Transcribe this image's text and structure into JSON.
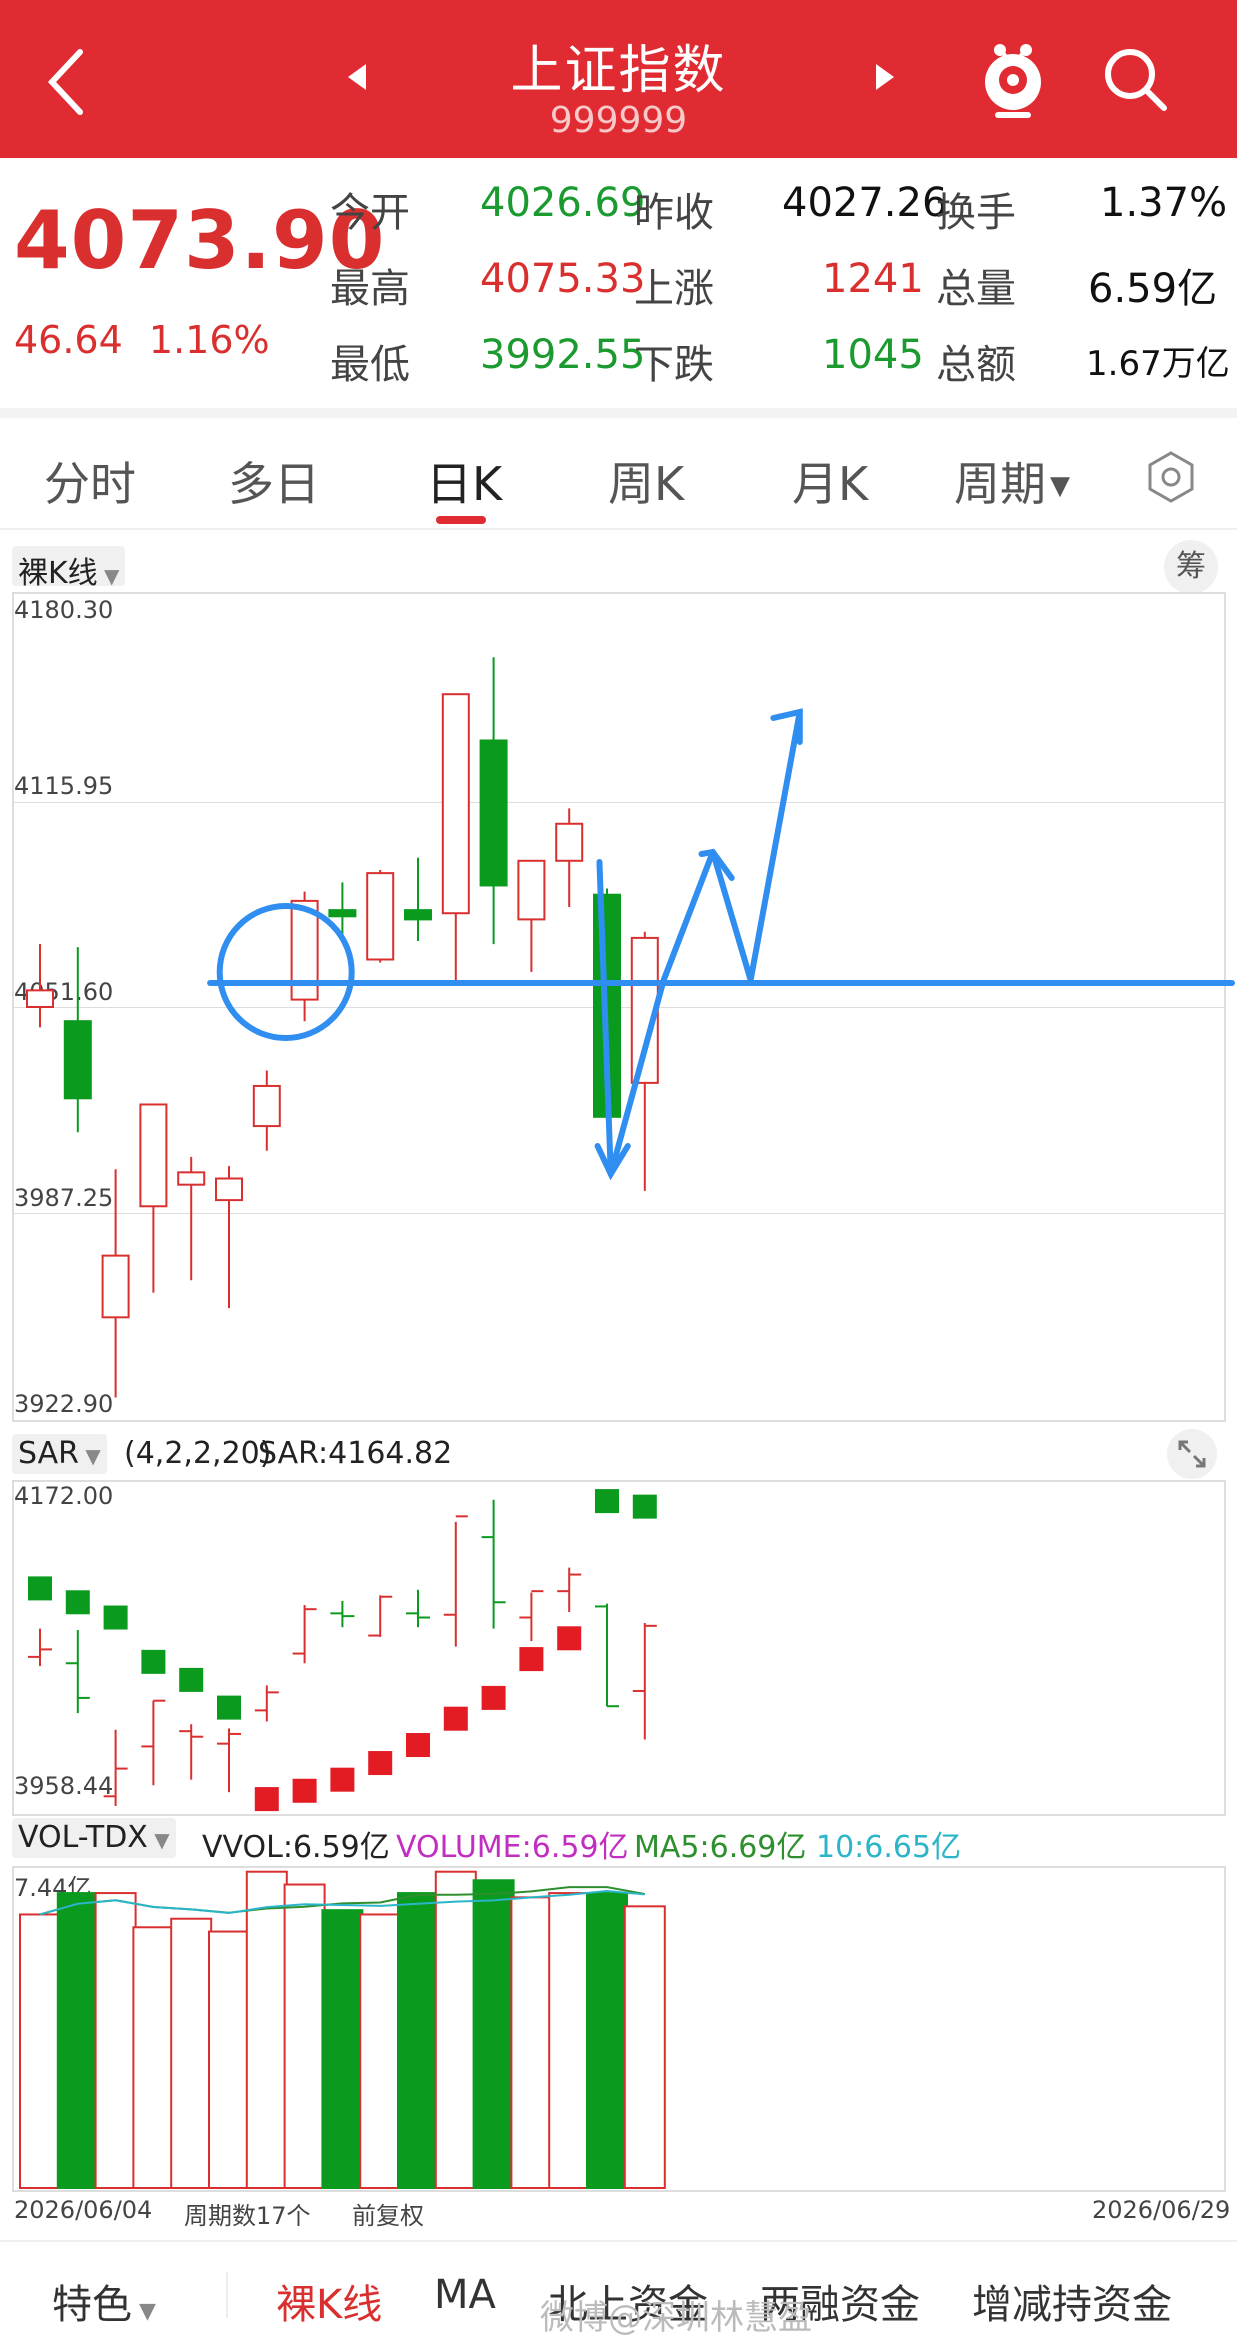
{
  "header": {
    "title": "上证指数",
    "code": "999999"
  },
  "quote": {
    "price": "4073.90",
    "change": "46.64",
    "change_pct": "1.16%",
    "rows": [
      {
        "l1": "今开",
        "v1": "4026.69",
        "c1": "green",
        "l2": "昨收",
        "v2": "4027.26",
        "c2": "black",
        "l3": "换手",
        "v3": "1.37%"
      },
      {
        "l1": "最高",
        "v1": "4075.33",
        "c1": "red",
        "l2": "上涨",
        "v2": "1241",
        "c2": "red",
        "l3": "总量",
        "v3": "6.59亿"
      },
      {
        "l1": "最低",
        "v1": "3992.55",
        "c1": "green",
        "l2": "下跌",
        "v2": "1045",
        "c2": "green",
        "l3": "总额",
        "v3": "1.67万亿"
      }
    ]
  },
  "tabs": {
    "items": [
      "分时",
      "多日",
      "日K",
      "周K",
      "月K",
      "周期"
    ],
    "active": "日K"
  },
  "kline": {
    "selector": "裸K线",
    "badge": "筹",
    "ticks": [
      "4180.30",
      "4115.95",
      "4051.60",
      "3987.25",
      "3922.90"
    ]
  },
  "sar": {
    "selector": "SAR",
    "params": "(4,2,2,20)",
    "value": "SAR:4164.82",
    "ticks": [
      "4172.00",
      "3958.44"
    ]
  },
  "vol": {
    "selector": "VOL-TDX",
    "vvol": "VVOL:6.59亿",
    "volume": "VOLUME:6.59亿",
    "ma5": "MA5:6.69亿",
    "ma10": "10:6.65亿",
    "top": "7.44亿",
    "date_start": "2026/06/04",
    "period": "周期数17个",
    "adjust": "前复权",
    "date_end": "2026/06/29"
  },
  "bottomnav": {
    "items": [
      "特色",
      "裸K线",
      "MA",
      "北上资金",
      "两融资金",
      "增减持资金"
    ],
    "active": "裸K线"
  },
  "watermark": "微博@深圳林慧盈",
  "colors": {
    "up": "#d9302f",
    "down": "#0a9a1e",
    "accent": "#e12b32",
    "annotation": "#2f8ef0"
  },
  "chart_data": [
    {
      "type": "candlestick",
      "title": "日K",
      "ylim": [
        3922.9,
        4180.3
      ],
      "x": [
        "2026/06/04",
        "",
        "",
        "",
        "",
        "",
        "",
        "",
        "",
        "",
        "",
        "",
        "",
        "",
        "",
        "",
        "2026/06/29"
      ],
      "ohlc": [
        {
          "o": 4051.6,
          "h": 4072,
          "l": 4045,
          "c": 4057,
          "up": true
        },
        {
          "o": 4047,
          "h": 4071,
          "l": 4011,
          "c": 4022,
          "up": false
        },
        {
          "o": 3951,
          "h": 3999,
          "l": 3925,
          "c": 3971,
          "up": true
        },
        {
          "o": 3987,
          "h": 4020,
          "l": 3959,
          "c": 4020,
          "up": true
        },
        {
          "o": 3998,
          "h": 4003,
          "l": 3963,
          "c": 3994,
          "up": true
        },
        {
          "o": 3989,
          "h": 4000,
          "l": 3954,
          "c": 3996,
          "up": true
        },
        {
          "o": 4013,
          "h": 4031,
          "l": 4005,
          "c": 4026,
          "up": true
        },
        {
          "o": 4054,
          "h": 4089,
          "l": 4047,
          "c": 4086,
          "up": true
        },
        {
          "o": 4083,
          "h": 4092,
          "l": 4073,
          "c": 4081,
          "up": false
        },
        {
          "o": 4067,
          "h": 4096,
          "l": 4066,
          "c": 4095,
          "up": true
        },
        {
          "o": 4083,
          "h": 4100,
          "l": 4073,
          "c": 4080,
          "up": false
        },
        {
          "o": 4082,
          "h": 4149,
          "l": 4059,
          "c": 4153,
          "up": true
        },
        {
          "o": 4138,
          "h": 4165,
          "l": 4072,
          "c": 4091,
          "up": false
        },
        {
          "o": 4080,
          "h": 4098,
          "l": 4063,
          "c": 4099,
          "up": true
        },
        {
          "o": 4099,
          "h": 4116,
          "l": 4084,
          "c": 4111,
          "up": true
        },
        {
          "o": 4088,
          "h": 4090,
          "l": 4016,
          "c": 4016,
          "up": false
        },
        {
          "o": 4027,
          "h": 4076,
          "l": 3992,
          "c": 4074,
          "up": true
        }
      ]
    },
    {
      "type": "scatter",
      "title": "SAR",
      "ylim": [
        3958.44,
        4172.0
      ],
      "dots": [
        {
          "v": 4101,
          "up": false
        },
        {
          "v": 4091,
          "up": false
        },
        {
          "v": 4080,
          "up": false
        },
        {
          "v": 4048,
          "up": false
        },
        {
          "v": 4035,
          "up": false
        },
        {
          "v": 4015,
          "up": false
        },
        {
          "v": 3949,
          "up": true
        },
        {
          "v": 3955,
          "up": true
        },
        {
          "v": 3963,
          "up": true
        },
        {
          "v": 3975,
          "up": true
        },
        {
          "v": 3988,
          "up": true
        },
        {
          "v": 4007,
          "up": true
        },
        {
          "v": 4022,
          "up": true
        },
        {
          "v": 4050,
          "up": true
        },
        {
          "v": 4065,
          "up": true
        },
        {
          "v": 4164,
          "up": false
        },
        {
          "v": 4160,
          "up": false
        }
      ]
    },
    {
      "type": "bar",
      "title": "VOL-TDX",
      "ylim": [
        0,
        7.44
      ],
      "values": [
        6.4,
        6.9,
        6.9,
        6.1,
        6.3,
        6.0,
        7.4,
        7.1,
        6.5,
        6.4,
        6.9,
        7.4,
        7.2,
        6.8,
        6.9,
        6.9,
        6.59
      ],
      "up": [
        true,
        false,
        true,
        true,
        true,
        true,
        true,
        true,
        false,
        true,
        false,
        true,
        false,
        true,
        true,
        false,
        true
      ]
    }
  ]
}
